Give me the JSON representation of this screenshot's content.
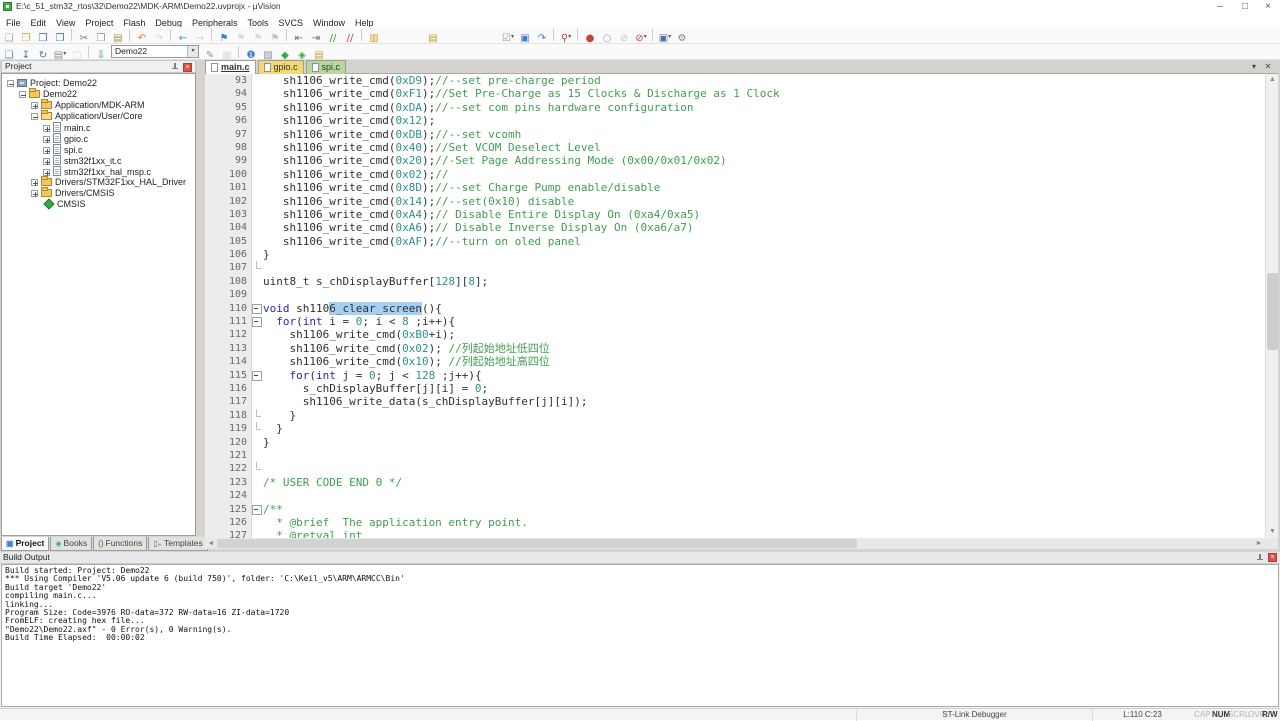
{
  "window": {
    "title": "E:\\c_51_stm32_rtos\\32\\Demo22\\MDK-ARM\\Demo22.uvprojx - µVision",
    "controls": [
      {
        "name": "minimize-icon",
        "glyph": "–"
      },
      {
        "name": "maximize-icon",
        "glyph": "□"
      },
      {
        "name": "close-icon",
        "glyph": "×"
      }
    ]
  },
  "menu": [
    "File",
    "Edit",
    "View",
    "Project",
    "Flash",
    "Debug",
    "Peripherals",
    "Tools",
    "SVCS",
    "Window",
    "Help"
  ],
  "toolbar1": [
    {
      "name": "new-file-icon",
      "glyph": "❏",
      "color": "#9aa4ae"
    },
    {
      "name": "open-file-icon",
      "glyph": "❐",
      "color": "#d8a838"
    },
    {
      "name": "save-icon",
      "glyph": "❒",
      "color": "#4a6fa5"
    },
    {
      "name": "save-all-icon",
      "glyph": "❒",
      "color": "#4a6fa5"
    },
    {
      "sep": true
    },
    {
      "name": "cut-icon",
      "glyph": "✂",
      "color": "#777"
    },
    {
      "name": "copy-icon",
      "glyph": "❐",
      "color": "#8a94a0"
    },
    {
      "name": "paste-icon",
      "glyph": "▤",
      "color": "#b08c50"
    },
    {
      "sep": true
    },
    {
      "name": "undo-icon",
      "glyph": "↶",
      "color": "#d8862a"
    },
    {
      "name": "redo-icon",
      "glyph": "↷",
      "color": "#d8862a",
      "dim": true
    },
    {
      "sep": true
    },
    {
      "name": "navigate-back-icon",
      "glyph": "←",
      "color": "#2a8fd8"
    },
    {
      "name": "navigate-forward-icon",
      "glyph": "→",
      "color": "#2a8fd8",
      "dim": true
    },
    {
      "sep": true
    },
    {
      "name": "bookmark-toggle-icon",
      "glyph": "⚑",
      "color": "#3a7fd0"
    },
    {
      "name": "bookmark-prev-icon",
      "glyph": "⚑",
      "color": "#9aa4ae",
      "dim": true
    },
    {
      "name": "bookmark-next-icon",
      "glyph": "⚑",
      "color": "#9aa4ae",
      "dim": true
    },
    {
      "name": "bookmark-clear-all-icon",
      "glyph": "⚑",
      "color": "#c4453a",
      "dim": true
    },
    {
      "sep": true
    },
    {
      "name": "unindent-icon",
      "glyph": "⇤",
      "color": "#5a6a7a"
    },
    {
      "name": "indent-icon",
      "glyph": "⇥",
      "color": "#5a6a7a"
    },
    {
      "name": "comment-icon",
      "glyph": "//",
      "color": "#3a8a3a"
    },
    {
      "name": "uncomment-icon",
      "glyph": "//",
      "color": "#c4453a"
    },
    {
      "sep": true
    },
    {
      "name": "find-in-files-icon",
      "glyph": "▥",
      "color": "#c9a227"
    },
    {
      "gap": 42
    },
    {
      "name": "books-icon",
      "glyph": "▤",
      "color": "#c9a227"
    },
    {
      "gap": 58
    },
    {
      "name": "debug-settings-icon",
      "glyph": "☑",
      "color": "#8a94a0",
      "dd": true
    },
    {
      "name": "system-viewer-icon",
      "glyph": "▣",
      "color": "#3a7fd0"
    },
    {
      "name": "debug-restore-views-icon",
      "glyph": "↷",
      "color": "#3a7fd0"
    },
    {
      "sep": true
    },
    {
      "name": "start-stop-debug-icon",
      "glyph": "⚲",
      "color": "#c4453a",
      "dd": true
    },
    {
      "sep": true
    },
    {
      "name": "insert-breakpoint-icon",
      "glyph": "●",
      "color": "#c4453a"
    },
    {
      "name": "enable-breakpoint-icon",
      "glyph": "○",
      "color": "#9aa4ae"
    },
    {
      "name": "disable-breakpoint-icon",
      "glyph": "⊘",
      "color": "#c4453a",
      "dim": true
    },
    {
      "name": "kill-all-breakpoints-icon",
      "glyph": "⊘",
      "color": "#c4453a",
      "dd": true
    },
    {
      "sep": true
    },
    {
      "name": "window-layout-icon",
      "glyph": "▣",
      "color": "#4a6fa5",
      "dd": true
    },
    {
      "name": "configure-icon",
      "glyph": "⚙",
      "color": "#7a848e"
    }
  ],
  "toolbar2": [
    {
      "name": "translate-file-icon",
      "glyph": "❏",
      "color": "#4a8fd0"
    },
    {
      "name": "build-icon",
      "glyph": "↧",
      "color": "#4a6fa5"
    },
    {
      "name": "rebuild-all-icon",
      "glyph": "↻",
      "color": "#4a6fa5"
    },
    {
      "name": "batch-build-icon",
      "glyph": "▤",
      "color": "#8a94a0",
      "dd": true
    },
    {
      "name": "stop-build-icon",
      "glyph": "▢",
      "color": "#9aa4ae",
      "dim": true
    },
    {
      "sep": true
    },
    {
      "name": "flash-download-icon",
      "glyph": "⇩",
      "color": "#3a9a3a"
    },
    {
      "combo": true,
      "name": "target-select-combo",
      "value": "Demo22"
    },
    {
      "name": "options-for-target-icon",
      "glyph": "✎",
      "color": "#8a94a0"
    },
    {
      "name": "file-extensions-icon",
      "glyph": "▦",
      "color": "#9aa4ae",
      "dim": true
    },
    {
      "sep": true
    },
    {
      "name": "manage-project-items-icon",
      "glyph": "❶",
      "color": "#3a7fd0"
    },
    {
      "name": "select-software-packs-icon",
      "glyph": "▧",
      "color": "#8a94a0"
    },
    {
      "name": "manage-rte-icon",
      "glyph": "◆",
      "color": "#36a93c"
    },
    {
      "name": "pack-installer-icon",
      "glyph": "◈",
      "color": "#36a93c"
    },
    {
      "name": "books-window-icon",
      "glyph": "▤",
      "color": "#c9a227"
    }
  ],
  "project_panel": {
    "title": "Project",
    "tree": [
      {
        "level": 0,
        "exp": "minus",
        "icon": "target",
        "label": "Project: Demo22"
      },
      {
        "level": 1,
        "exp": "minus",
        "icon": "folder",
        "label": "Demo22"
      },
      {
        "level": 2,
        "exp": "plus",
        "icon": "folder",
        "label": "Application/MDK-ARM"
      },
      {
        "level": 2,
        "exp": "minus",
        "icon": "folder-open",
        "label": "Application/User/Core"
      },
      {
        "level": 3,
        "exp": "plus",
        "icon": "file",
        "label": "main.c"
      },
      {
        "level": 3,
        "exp": "plus",
        "icon": "file",
        "label": "gpio.c"
      },
      {
        "level": 3,
        "exp": "plus",
        "icon": "file",
        "label": "spi.c"
      },
      {
        "level": 3,
        "exp": "plus",
        "icon": "file",
        "label": "stm32f1xx_it.c"
      },
      {
        "level": 3,
        "exp": "plus",
        "icon": "file",
        "label": "stm32f1xx_hal_msp.c"
      },
      {
        "level": 2,
        "exp": "plus",
        "icon": "folder",
        "label": "Drivers/STM32F1xx_HAL_Driver"
      },
      {
        "level": 2,
        "exp": "plus",
        "icon": "folder",
        "label": "Drivers/CMSIS"
      },
      {
        "level": 2,
        "exp": null,
        "icon": "cmsis",
        "label": "CMSIS"
      }
    ],
    "tabs": [
      {
        "label": "Project",
        "icon": "project-icon",
        "glyph": "▣",
        "color": "#3a7fd0",
        "active": true
      },
      {
        "label": "Books",
        "icon": "books-icon",
        "glyph": "◈",
        "color": "#2aa06a",
        "active": false
      },
      {
        "label": "Functions",
        "icon": "functions-icon",
        "glyph": "()",
        "color": "#555",
        "active": false
      },
      {
        "label": "Templates",
        "icon": "templates-icon",
        "glyph": "▯₊",
        "color": "#4a6fd0",
        "active": false
      }
    ]
  },
  "editor": {
    "tabs": [
      {
        "label": "main.c",
        "state": "active"
      },
      {
        "label": "gpio.c",
        "state": "yellow"
      },
      {
        "label": "spi.c",
        "state": "green"
      }
    ],
    "controls": [
      {
        "name": "document-list-dropdown-icon",
        "glyph": "▾"
      },
      {
        "name": "close-document-icon",
        "glyph": "✕"
      }
    ],
    "lines": [
      {
        "n": 93,
        "fold": null,
        "segs": [
          [
            "   sh1106_write_cmd(",
            "p"
          ],
          [
            "0xD9",
            "n"
          ],
          [
            ");",
            "p"
          ],
          [
            "//--set pre-charge period",
            "c"
          ]
        ]
      },
      {
        "n": 94,
        "fold": null,
        "segs": [
          [
            "   sh1106_write_cmd(",
            "p"
          ],
          [
            "0xF1",
            "n"
          ],
          [
            ");",
            "p"
          ],
          [
            "//Set Pre-Charge as 15 Clocks & Discharge as 1 Clock",
            "c"
          ]
        ]
      },
      {
        "n": 95,
        "fold": null,
        "segs": [
          [
            "   sh1106_write_cmd(",
            "p"
          ],
          [
            "0xDA",
            "n"
          ],
          [
            ");",
            "p"
          ],
          [
            "//--set com pins hardware configuration",
            "c"
          ]
        ]
      },
      {
        "n": 96,
        "fold": null,
        "segs": [
          [
            "   sh1106_write_cmd(",
            "p"
          ],
          [
            "0x12",
            "n"
          ],
          [
            ");",
            "p"
          ]
        ]
      },
      {
        "n": 97,
        "fold": null,
        "segs": [
          [
            "   sh1106_write_cmd(",
            "p"
          ],
          [
            "0xDB",
            "n"
          ],
          [
            ");",
            "p"
          ],
          [
            "//--set vcomh",
            "c"
          ]
        ]
      },
      {
        "n": 98,
        "fold": null,
        "segs": [
          [
            "   sh1106_write_cmd(",
            "p"
          ],
          [
            "0x40",
            "n"
          ],
          [
            ");",
            "p"
          ],
          [
            "//Set VCOM Deselect Level",
            "c"
          ]
        ]
      },
      {
        "n": 99,
        "fold": null,
        "segs": [
          [
            "   sh1106_write_cmd(",
            "p"
          ],
          [
            "0x20",
            "n"
          ],
          [
            ");",
            "p"
          ],
          [
            "//-Set Page Addressing Mode (0x00/0x01/0x02)",
            "c"
          ]
        ]
      },
      {
        "n": 100,
        "fold": null,
        "segs": [
          [
            "   sh1106_write_cmd(",
            "p"
          ],
          [
            "0x02",
            "n"
          ],
          [
            ");",
            "p"
          ],
          [
            "//",
            "c"
          ]
        ]
      },
      {
        "n": 101,
        "fold": null,
        "segs": [
          [
            "   sh1106_write_cmd(",
            "p"
          ],
          [
            "0x8D",
            "n"
          ],
          [
            ");",
            "p"
          ],
          [
            "//--set Charge Pump enable/disable",
            "c"
          ]
        ]
      },
      {
        "n": 102,
        "fold": null,
        "segs": [
          [
            "   sh1106_write_cmd(",
            "p"
          ],
          [
            "0x14",
            "n"
          ],
          [
            ");",
            "p"
          ],
          [
            "//--set(0x10) disable",
            "c"
          ]
        ]
      },
      {
        "n": 103,
        "fold": null,
        "segs": [
          [
            "   sh1106_write_cmd(",
            "p"
          ],
          [
            "0xA4",
            "n"
          ],
          [
            ");",
            "p"
          ],
          [
            "// Disable Entire Display On (0xa4/0xa5)",
            "c"
          ]
        ]
      },
      {
        "n": 104,
        "fold": null,
        "segs": [
          [
            "   sh1106_write_cmd(",
            "p"
          ],
          [
            "0xA6",
            "n"
          ],
          [
            ");",
            "p"
          ],
          [
            "// Disable Inverse Display On (0xa6/a7)",
            "c"
          ]
        ]
      },
      {
        "n": 105,
        "fold": null,
        "segs": [
          [
            "   sh1106_write_cmd(",
            "p"
          ],
          [
            "0xAF",
            "n"
          ],
          [
            ");",
            "p"
          ],
          [
            "//--turn on oled panel",
            "c"
          ]
        ]
      },
      {
        "n": 106,
        "fold": null,
        "segs": [
          [
            "}",
            "p"
          ]
        ]
      },
      {
        "n": 107,
        "fold": "end",
        "segs": []
      },
      {
        "n": 108,
        "fold": null,
        "segs": [
          [
            "uint8_t s_chDisplayBuffer[",
            "p"
          ],
          [
            "128",
            "n"
          ],
          [
            "][",
            "p"
          ],
          [
            "8",
            "n"
          ],
          [
            "];",
            "p"
          ]
        ]
      },
      {
        "n": 109,
        "fold": null,
        "segs": []
      },
      {
        "n": 110,
        "fold": "open",
        "segs": [
          [
            "void",
            "k"
          ],
          [
            " sh110",
            "p"
          ],
          [
            "6_clear_screen",
            "s"
          ],
          [
            "(){",
            "p"
          ]
        ]
      },
      {
        "n": 111,
        "fold": "open",
        "segs": [
          [
            "  ",
            "p"
          ],
          [
            "for",
            "k"
          ],
          [
            "(",
            "p"
          ],
          [
            "int",
            "k"
          ],
          [
            " i = ",
            "p"
          ],
          [
            "0",
            "n"
          ],
          [
            "; i < ",
            "p"
          ],
          [
            "8",
            "n"
          ],
          [
            " ;i++){",
            "p"
          ]
        ]
      },
      {
        "n": 112,
        "fold": null,
        "segs": [
          [
            "    sh1106_write_cmd(",
            "p"
          ],
          [
            "0xB0",
            "n"
          ],
          [
            "+i);",
            "p"
          ]
        ]
      },
      {
        "n": 113,
        "fold": null,
        "segs": [
          [
            "    sh1106_write_cmd(",
            "p"
          ],
          [
            "0x02",
            "n"
          ],
          [
            "); ",
            "p"
          ],
          [
            "//列起始地址低四位",
            "c"
          ]
        ]
      },
      {
        "n": 114,
        "fold": null,
        "segs": [
          [
            "    sh1106_write_cmd(",
            "p"
          ],
          [
            "0x10",
            "n"
          ],
          [
            "); ",
            "p"
          ],
          [
            "//列起始地址高四位",
            "c"
          ]
        ]
      },
      {
        "n": 115,
        "fold": "open",
        "segs": [
          [
            "    ",
            "p"
          ],
          [
            "for",
            "k"
          ],
          [
            "(",
            "p"
          ],
          [
            "int",
            "k"
          ],
          [
            " j = ",
            "p"
          ],
          [
            "0",
            "n"
          ],
          [
            "; j < ",
            "p"
          ],
          [
            "128",
            "n"
          ],
          [
            " ;j++){",
            "p"
          ]
        ]
      },
      {
        "n": 116,
        "fold": null,
        "segs": [
          [
            "      s_chDisplayBuffer[j][i] = ",
            "p"
          ],
          [
            "0",
            "n"
          ],
          [
            ";",
            "p"
          ]
        ]
      },
      {
        "n": 117,
        "fold": null,
        "segs": [
          [
            "      sh1106_write_data(s_chDisplayBuffer[j][i]);",
            "p"
          ]
        ]
      },
      {
        "n": 118,
        "fold": "end",
        "segs": [
          [
            "    }",
            "p"
          ]
        ]
      },
      {
        "n": 119,
        "fold": "end",
        "segs": [
          [
            "  }",
            "p"
          ]
        ]
      },
      {
        "n": 120,
        "fold": null,
        "segs": [
          [
            "}",
            "p"
          ]
        ]
      },
      {
        "n": 121,
        "fold": null,
        "segs": []
      },
      {
        "n": 122,
        "fold": "end",
        "segs": []
      },
      {
        "n": 123,
        "fold": null,
        "segs": [
          [
            "/* USER CODE END 0 */",
            "c"
          ]
        ]
      },
      {
        "n": 124,
        "fold": null,
        "segs": []
      },
      {
        "n": 125,
        "fold": "open",
        "segs": [
          [
            "/**",
            "c"
          ]
        ]
      },
      {
        "n": 126,
        "fold": null,
        "segs": [
          [
            "  * @brief  The application entry point.",
            "c"
          ]
        ]
      },
      {
        "n": 127,
        "fold": null,
        "segs": [
          [
            "  * @retval int",
            "c"
          ]
        ]
      }
    ]
  },
  "build_output": {
    "title": "Build Output",
    "lines": [
      "Build started: Project: Demo22",
      "*** Using Compiler 'V5.06 update 6 (build 750)', folder: 'C:\\Keil_v5\\ARM\\ARMCC\\Bin'",
      "Build target 'Demo22'",
      "compiling main.c...",
      "linking...",
      "Program Size: Code=3976 RO-data=372 RW-data=16 ZI-data=1720",
      "FromELF: creating hex file...",
      "\"Demo22\\Demo22.axf\" - 0 Error(s), 0 Warning(s).",
      "Build Time Elapsed:  00:00:02"
    ]
  },
  "status_bar": {
    "debugger": "ST-Link Debugger",
    "position": "L:110 C:23",
    "flags": [
      {
        "label": "CAP",
        "on": false
      },
      {
        "label": "NUM",
        "on": true
      },
      {
        "label": "SCRL",
        "on": false
      },
      {
        "label": "OVR",
        "on": false
      },
      {
        "label": "R/W",
        "on": true
      }
    ]
  },
  "colors": {
    "keyword": "#2828b8",
    "comment": "#3f9e4f",
    "number": "#2f8f8f",
    "selection": "#a5d0f3",
    "tab_modified_yellow": "#f4d873",
    "tab_modified_green": "#b8d89a"
  }
}
